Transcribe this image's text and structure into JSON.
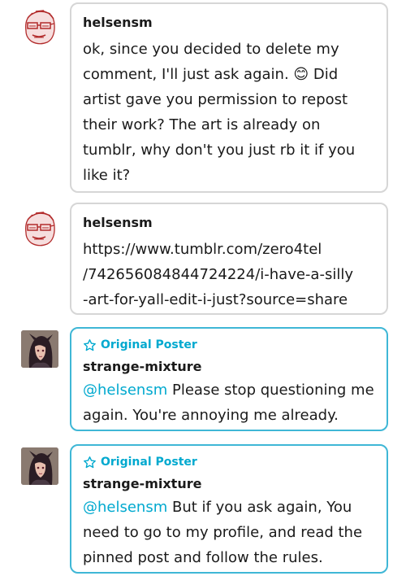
{
  "comments": [
    {
      "username": "helsensm",
      "text_before_emoji": "ok, since you decided to delete my comment, I'll just ask again. ",
      "emoji": "😊",
      "text_after_emoji": " Did artist gave you permission to repost their work? The art is already on tumblr, why don't you just rb it if you like it?",
      "avatar_icon": "red-sketch-face-icon"
    },
    {
      "username": "helsensm",
      "link_lines": [
        "https://www.tumblr.com/zero4tel",
        "/742656084844724224/i-have-a-silly",
        "-art-for-yall-edit-i-just?source=share"
      ],
      "avatar_icon": "red-sketch-face-icon"
    },
    {
      "badge": "Original Poster",
      "badge_icon": "star-outline-icon",
      "username": "strange-mixture",
      "mention": "@helsensm",
      "text": " Please stop questioning me again. You're annoying me already.",
      "avatar_icon": "dark-haired-character-icon"
    },
    {
      "badge": "Original Poster",
      "badge_icon": "star-outline-icon",
      "username": "strange-mixture",
      "mention": "@helsensm",
      "text": " But if you ask again, You need to go to my profile, and read the pinned post and follow the rules.",
      "avatar_icon": "dark-haired-character-icon"
    }
  ],
  "colors": {
    "accent": "#00a9cf",
    "op_border": "#3fb7d6",
    "bubble_border": "#d6d6d6"
  }
}
